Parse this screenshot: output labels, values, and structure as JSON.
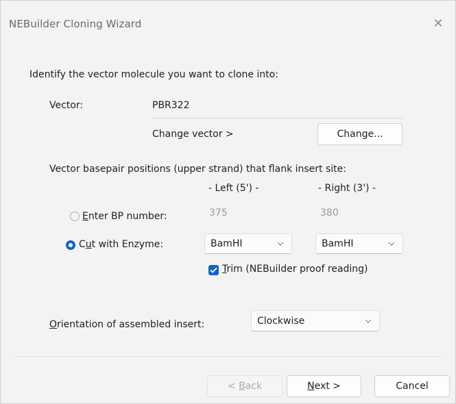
{
  "window": {
    "title": "NEBuilder Cloning Wizard",
    "close_glyph": "✕"
  },
  "intro": "Identify the vector molecule you want to clone into:",
  "vector": {
    "label": "Vector:",
    "value": "PBR322",
    "change_vector_text": "Change vector  >",
    "change_button": "Change..."
  },
  "flank": {
    "heading": "Vector basepair positions (upper strand) that flank insert site:",
    "left_header": "- Left (5') -",
    "right_header": "- Right (3') -"
  },
  "bp": {
    "label_access": "E",
    "label_rest": "nter BP number:",
    "left_value": "375",
    "right_value": "380",
    "selected": false
  },
  "enzyme": {
    "label_pre": "C",
    "label_access": "u",
    "label_rest": "t with Enzyme:",
    "left_value": "BamHI",
    "right_value": "BamHI",
    "selected": true
  },
  "trim": {
    "label_access": "T",
    "label_rest": "rim (NEBuilder proof reading)",
    "checked": true
  },
  "orientation": {
    "label_access": "O",
    "label_rest": "rientation of assembled insert:",
    "value": "Clockwise"
  },
  "footer": {
    "back_pre": "< ",
    "back_access": "B",
    "back_rest": "ack",
    "next_access": "N",
    "next_rest": "ext >",
    "cancel": "Cancel"
  },
  "colors": {
    "accent": "#1164c7",
    "window_bg": "#f3f3f3"
  },
  "icons": [
    "close-icon",
    "chevron-down-icon",
    "checkmark-icon",
    "radio-icon"
  ]
}
